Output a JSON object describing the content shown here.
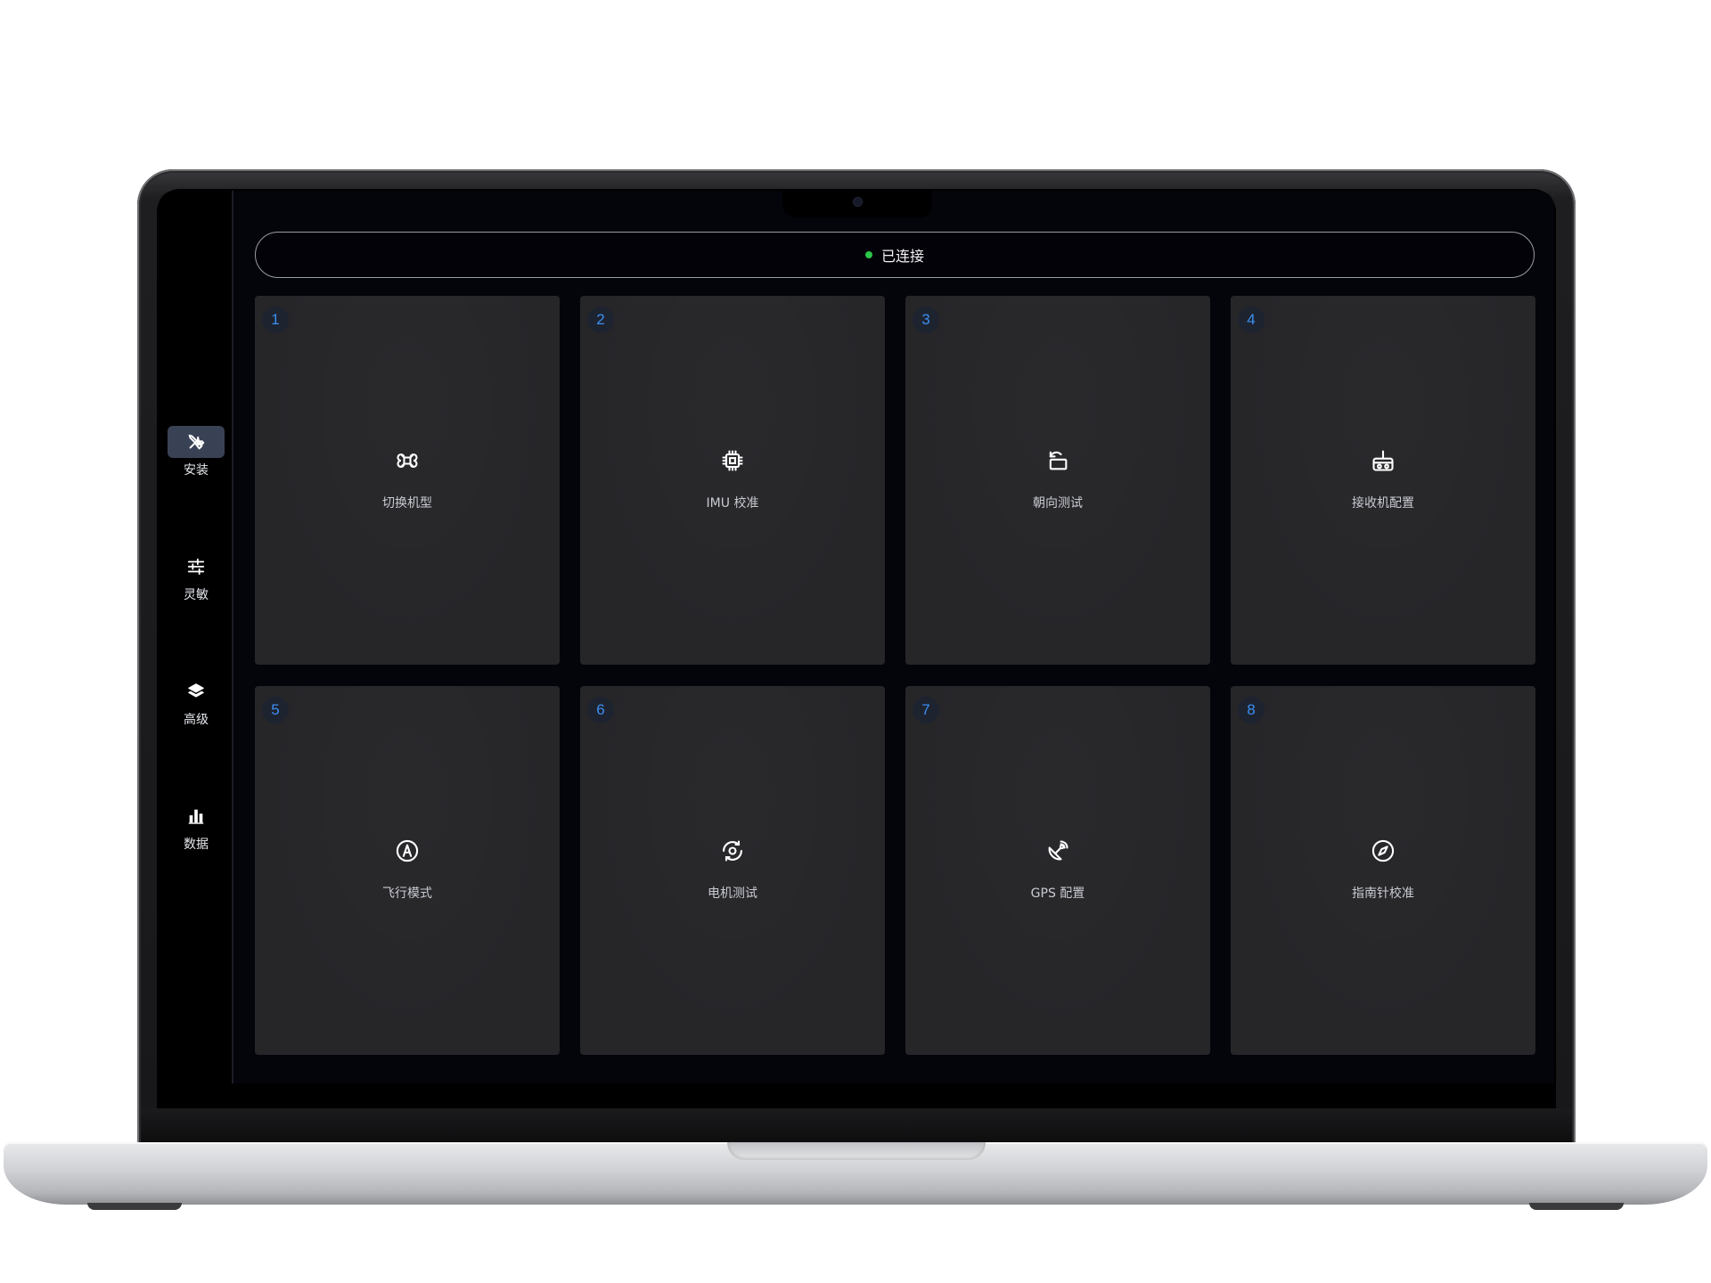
{
  "status": {
    "label": "已连接",
    "color": "#2bc54a"
  },
  "sidebar": {
    "items": [
      {
        "label": "安装",
        "icon": "tools-icon",
        "active": true
      },
      {
        "label": "灵敏",
        "icon": "sliders-icon",
        "active": false
      },
      {
        "label": "高级",
        "icon": "layers-icon",
        "active": false
      },
      {
        "label": "数据",
        "icon": "bar-chart-icon",
        "active": false
      }
    ]
  },
  "tiles": [
    {
      "num": "1",
      "label": "切换机型",
      "icon": "drone-icon"
    },
    {
      "num": "2",
      "label": "IMU 校准",
      "icon": "chip-icon"
    },
    {
      "num": "3",
      "label": "朝向测试",
      "icon": "rotate-icon"
    },
    {
      "num": "4",
      "label": "接收机配置",
      "icon": "radio-receiver-icon"
    },
    {
      "num": "5",
      "label": "飞行模式",
      "icon": "flight-mode-icon"
    },
    {
      "num": "6",
      "label": "电机测试",
      "icon": "motor-icon"
    },
    {
      "num": "7",
      "label": "GPS 配置",
      "icon": "satellite-dish-icon"
    },
    {
      "num": "8",
      "label": "指南针校准",
      "icon": "compass-icon"
    }
  ],
  "colors": {
    "accent": "#3b8ff0",
    "tile_bg": "#262629",
    "active_nav": "#394255"
  }
}
